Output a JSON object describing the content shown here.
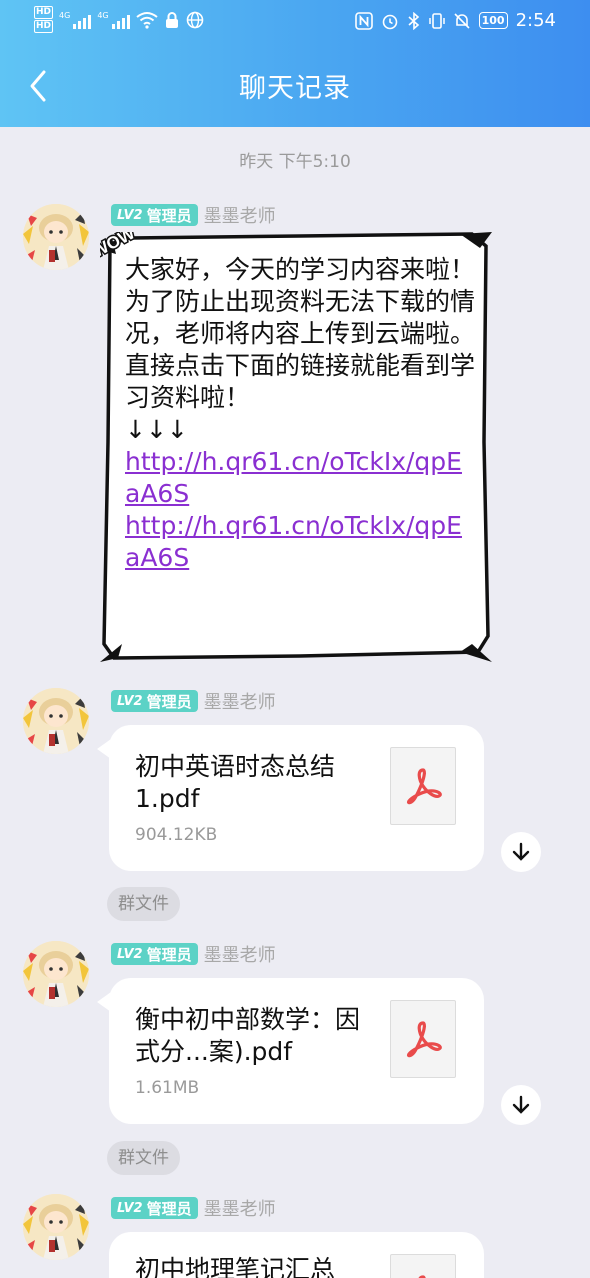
{
  "status_bar": {
    "hd_top": "HD",
    "hd_bottom": "HD",
    "signal1_tag": "4G",
    "signal2_tag": "4G",
    "battery": "100",
    "time": "2:54"
  },
  "header": {
    "title": "聊天记录"
  },
  "chat": {
    "time_separator": "昨天 下午5:10",
    "messages": [
      {
        "badge_level": "LV2",
        "badge_role": "管理员",
        "sender": "墨墨老师",
        "text_lines": [
          "大家好，今天的学习内容来啦！",
          "为了防止出现资料无法下载的情况，老师将内容上传到云端啦。",
          "直接点击下面的链接就能看到学习资料啦！",
          "↓↓↓"
        ],
        "links": [
          "http://h.qr61.cn/oTckIx/qpEaA6S",
          "http://h.qr61.cn/oTckIx/qpEaA6S"
        ],
        "bubble_sticker": "WOW"
      },
      {
        "badge_level": "LV2",
        "badge_role": "管理员",
        "sender": "墨墨老师",
        "file_name": "初中英语时态总结1.pdf",
        "file_size": "904.12KB",
        "group_tag": "群文件"
      },
      {
        "badge_level": "LV2",
        "badge_role": "管理员",
        "sender": "墨墨老师",
        "file_name": "衡中初中部数学：因式分...案).pdf",
        "file_size": "1.61MB",
        "group_tag": "群文件"
      },
      {
        "badge_level": "LV2",
        "badge_role": "管理员",
        "sender": "墨墨老师",
        "file_name": "初中地理笔记汇总"
      }
    ]
  },
  "colors": {
    "header_gradient_start": "#5fc4f4",
    "header_gradient_end": "#3d8ef0",
    "badge": "#5cd2c6",
    "link": "#8a2fd1",
    "pdf_red": "#e94b4b",
    "background": "#ececf3"
  },
  "icons": {
    "back": "chevron-left-icon",
    "pdf": "pdf-icon",
    "download": "arrow-down-icon"
  }
}
